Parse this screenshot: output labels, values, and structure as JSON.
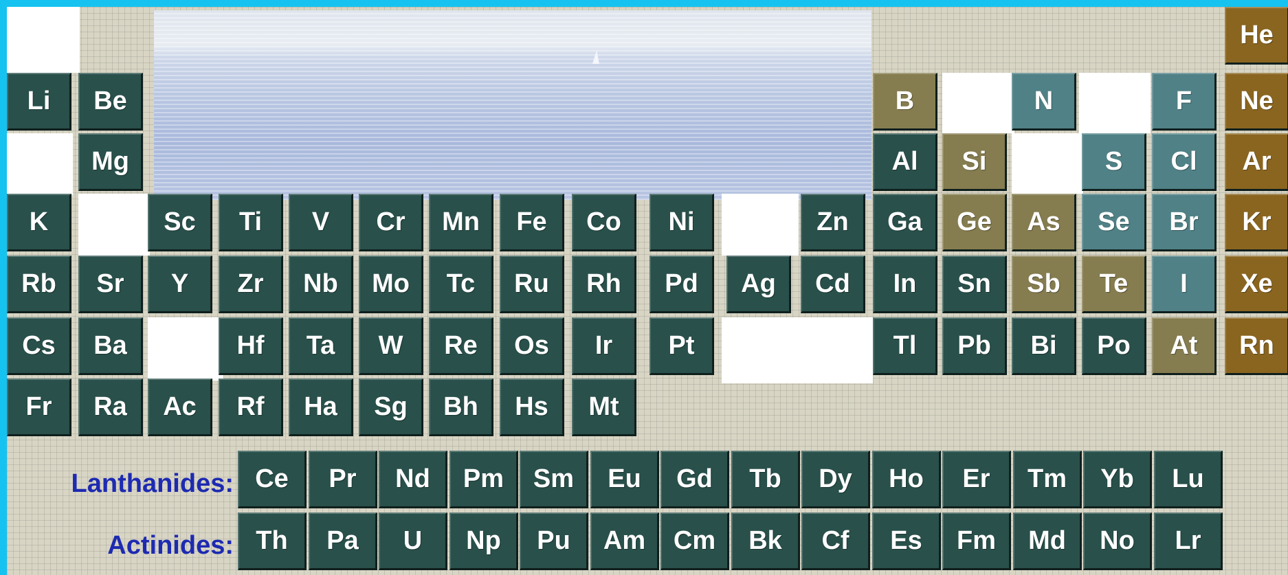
{
  "main_table": [
    {
      "symbol": "He",
      "group": 18,
      "period": 1,
      "category": "noble"
    },
    {
      "symbol": "Li",
      "group": 1,
      "period": 2,
      "category": "metal"
    },
    {
      "symbol": "Be",
      "group": 2,
      "period": 2,
      "category": "metal"
    },
    {
      "symbol": "B",
      "group": 13,
      "period": 2,
      "category": "metalloid"
    },
    {
      "symbol": "N",
      "group": 15,
      "period": 2,
      "category": "nonmetal"
    },
    {
      "symbol": "F",
      "group": 17,
      "period": 2,
      "category": "nonmetal"
    },
    {
      "symbol": "Ne",
      "group": 18,
      "period": 2,
      "category": "noble"
    },
    {
      "symbol": "Mg",
      "group": 2,
      "period": 3,
      "category": "metal"
    },
    {
      "symbol": "Al",
      "group": 13,
      "period": 3,
      "category": "metal"
    },
    {
      "symbol": "Si",
      "group": 14,
      "period": 3,
      "category": "metalloid"
    },
    {
      "symbol": "S",
      "group": 16,
      "period": 3,
      "category": "nonmetal"
    },
    {
      "symbol": "Cl",
      "group": 17,
      "period": 3,
      "category": "nonmetal"
    },
    {
      "symbol": "Ar",
      "group": 18,
      "period": 3,
      "category": "noble"
    },
    {
      "symbol": "K",
      "group": 1,
      "period": 4,
      "category": "metal"
    },
    {
      "symbol": "Sc",
      "group": 3,
      "period": 4,
      "category": "metal"
    },
    {
      "symbol": "Ti",
      "group": 4,
      "period": 4,
      "category": "metal"
    },
    {
      "symbol": "V",
      "group": 5,
      "period": 4,
      "category": "metal"
    },
    {
      "symbol": "Cr",
      "group": 6,
      "period": 4,
      "category": "metal"
    },
    {
      "symbol": "Mn",
      "group": 7,
      "period": 4,
      "category": "metal"
    },
    {
      "symbol": "Fe",
      "group": 8,
      "period": 4,
      "category": "metal"
    },
    {
      "symbol": "Co",
      "group": 9,
      "period": 4,
      "category": "metal"
    },
    {
      "symbol": "Ni",
      "group": 10,
      "period": 4,
      "category": "metal"
    },
    {
      "symbol": "Zn",
      "group": 12,
      "period": 4,
      "category": "metal"
    },
    {
      "symbol": "Ga",
      "group": 13,
      "period": 4,
      "category": "metal"
    },
    {
      "symbol": "Ge",
      "group": 14,
      "period": 4,
      "category": "metalloid"
    },
    {
      "symbol": "As",
      "group": 15,
      "period": 4,
      "category": "metalloid"
    },
    {
      "symbol": "Se",
      "group": 16,
      "period": 4,
      "category": "nonmetal"
    },
    {
      "symbol": "Br",
      "group": 17,
      "period": 4,
      "category": "nonmetal"
    },
    {
      "symbol": "Kr",
      "group": 18,
      "period": 4,
      "category": "noble"
    },
    {
      "symbol": "Rb",
      "group": 1,
      "period": 5,
      "category": "metal"
    },
    {
      "symbol": "Sr",
      "group": 2,
      "period": 5,
      "category": "metal"
    },
    {
      "symbol": "Y",
      "group": 3,
      "period": 5,
      "category": "metal"
    },
    {
      "symbol": "Zr",
      "group": 4,
      "period": 5,
      "category": "metal"
    },
    {
      "symbol": "Nb",
      "group": 5,
      "period": 5,
      "category": "metal"
    },
    {
      "symbol": "Mo",
      "group": 6,
      "period": 5,
      "category": "metal"
    },
    {
      "symbol": "Tc",
      "group": 7,
      "period": 5,
      "category": "metal"
    },
    {
      "symbol": "Ru",
      "group": 8,
      "period": 5,
      "category": "metal"
    },
    {
      "symbol": "Rh",
      "group": 9,
      "period": 5,
      "category": "metal"
    },
    {
      "symbol": "Pd",
      "group": 10,
      "period": 5,
      "category": "metal"
    },
    {
      "symbol": "Ag",
      "group": 11,
      "period": 5,
      "category": "metal"
    },
    {
      "symbol": "Cd",
      "group": 12,
      "period": 5,
      "category": "metal"
    },
    {
      "symbol": "In",
      "group": 13,
      "period": 5,
      "category": "metal"
    },
    {
      "symbol": "Sn",
      "group": 14,
      "period": 5,
      "category": "metal"
    },
    {
      "symbol": "Sb",
      "group": 15,
      "period": 5,
      "category": "metalloid"
    },
    {
      "symbol": "Te",
      "group": 16,
      "period": 5,
      "category": "metalloid"
    },
    {
      "symbol": "I",
      "group": 17,
      "period": 5,
      "category": "nonmetal"
    },
    {
      "symbol": "Xe",
      "group": 18,
      "period": 5,
      "category": "noble"
    },
    {
      "symbol": "Cs",
      "group": 1,
      "period": 6,
      "category": "metal"
    },
    {
      "symbol": "Ba",
      "group": 2,
      "period": 6,
      "category": "metal"
    },
    {
      "symbol": "Hf",
      "group": 4,
      "period": 6,
      "category": "metal"
    },
    {
      "symbol": "Ta",
      "group": 5,
      "period": 6,
      "category": "metal"
    },
    {
      "symbol": "W",
      "group": 6,
      "period": 6,
      "category": "metal"
    },
    {
      "symbol": "Re",
      "group": 7,
      "period": 6,
      "category": "metal"
    },
    {
      "symbol": "Os",
      "group": 8,
      "period": 6,
      "category": "metal"
    },
    {
      "symbol": "Ir",
      "group": 9,
      "period": 6,
      "category": "metal"
    },
    {
      "symbol": "Pt",
      "group": 10,
      "period": 6,
      "category": "metal"
    },
    {
      "symbol": "Tl",
      "group": 13,
      "period": 6,
      "category": "metal"
    },
    {
      "symbol": "Pb",
      "group": 14,
      "period": 6,
      "category": "metal"
    },
    {
      "symbol": "Bi",
      "group": 15,
      "period": 6,
      "category": "metal"
    },
    {
      "symbol": "Po",
      "group": 16,
      "period": 6,
      "category": "metal"
    },
    {
      "symbol": "At",
      "group": 17,
      "period": 6,
      "category": "metalloid"
    },
    {
      "symbol": "Rn",
      "group": 18,
      "period": 6,
      "category": "noble"
    },
    {
      "symbol": "Fr",
      "group": 1,
      "period": 7,
      "category": "metal"
    },
    {
      "symbol": "Ra",
      "group": 2,
      "period": 7,
      "category": "metal"
    },
    {
      "symbol": "Ac",
      "group": 3,
      "period": 7,
      "category": "metal"
    },
    {
      "symbol": "Rf",
      "group": 4,
      "period": 7,
      "category": "metal"
    },
    {
      "symbol": "Ha",
      "group": 5,
      "period": 7,
      "category": "metal"
    },
    {
      "symbol": "Sg",
      "group": 6,
      "period": 7,
      "category": "metal"
    },
    {
      "symbol": "Bh",
      "group": 7,
      "period": 7,
      "category": "metal"
    },
    {
      "symbol": "Hs",
      "group": 8,
      "period": 7,
      "category": "metal"
    },
    {
      "symbol": "Mt",
      "group": 9,
      "period": 7,
      "category": "metal"
    }
  ],
  "lanthanides": {
    "label": "Lanthanides:",
    "symbols": [
      "Ce",
      "Pr",
      "Nd",
      "Pm",
      "Sm",
      "Eu",
      "Gd",
      "Tb",
      "Dy",
      "Ho",
      "Er",
      "Tm",
      "Yb",
      "Lu"
    ]
  },
  "actinides": {
    "label": "Actinides:",
    "symbols": [
      "Th",
      "Pa",
      "U",
      "Np",
      "Pu",
      "Am",
      "Cm",
      "Bk",
      "Cf",
      "Es",
      "Fm",
      "Md",
      "No",
      "Lr"
    ]
  },
  "colors": {
    "metal": "#29504b",
    "metalloid": "#857c4f",
    "nonmetal": "#4f8186",
    "noble": "#8a6520",
    "label_text": "#1d2ab1",
    "frame": "#16c3f0"
  }
}
